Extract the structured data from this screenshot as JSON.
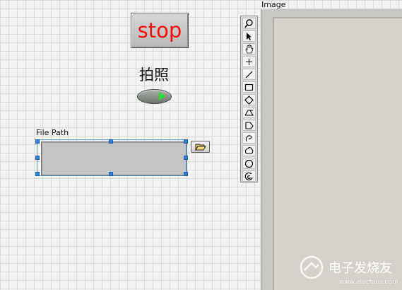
{
  "stop_button": {
    "label": "stop"
  },
  "capture_button": {
    "label": "拍照"
  },
  "file_path": {
    "label": "File Path",
    "value": ""
  },
  "image_display": {
    "label": "Image"
  },
  "tools": [
    "zoom-tool-icon",
    "select-arrow-icon",
    "pan-hand-icon",
    "crosshair-point-icon",
    "line-tool-icon",
    "rectangle-tool-icon",
    "rotated-rect-tool-icon",
    "annulus-tool-icon",
    "polygon-tool-icon",
    "freehand-tool-icon",
    "freehand-region-icon",
    "oval-tool-icon",
    "annulus-arc-icon"
  ],
  "watermark": {
    "text": "电子发烧友",
    "url": "www.elecfans.com"
  }
}
